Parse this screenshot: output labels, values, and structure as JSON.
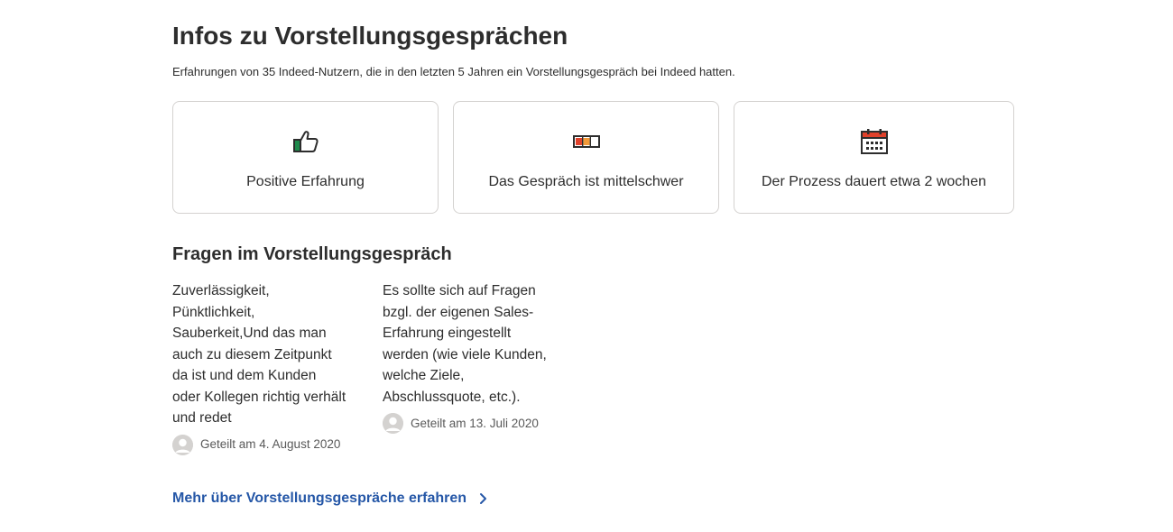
{
  "header": {
    "title": "Infos zu Vorstellungsgesprächen",
    "subtitle": "Erfahrungen von 35 Indeed-Nutzern, die in den letzten 5 Jahren ein Vorstellungsgespräch bei Indeed hatten."
  },
  "cards": [
    {
      "icon": "thumbs-up-icon",
      "label": "Positive Erfahrung"
    },
    {
      "icon": "difficulty-meter-icon",
      "label": "Das Gespräch ist mittelschwer"
    },
    {
      "icon": "calendar-icon",
      "label": "Der Prozess dauert etwa 2 wochen"
    }
  ],
  "questions_section": {
    "title": "Fragen im Vorstellungsgespräch",
    "items": [
      {
        "text": "Zuverlässigkeit, Pünktlichkeit, Sauberkeit,Und das man auch zu diesem Zeitpunkt da ist und dem Kunden oder Kollegen richtig verhält und redet",
        "shared": "Geteilt am 4. August 2020"
      },
      {
        "text": "Es sollte sich auf Fragen bzgl. der eigenen Sales-Erfahrung eingestellt werden (wie viele Kunden, welche Ziele, Abschlussquote, etc.).",
        "shared": "Geteilt am 13. Juli 2020"
      }
    ]
  },
  "more_link": {
    "label": "Mehr über Vorstellungsgespräche erfahren"
  },
  "colors": {
    "text": "#2d2d2d",
    "link": "#2557a7",
    "border": "#d4d2d0",
    "thumb_green": "#1f8a4c",
    "meter_red": "#e0412b",
    "meter_orange": "#f29a38",
    "calendar_red": "#e0412b"
  }
}
